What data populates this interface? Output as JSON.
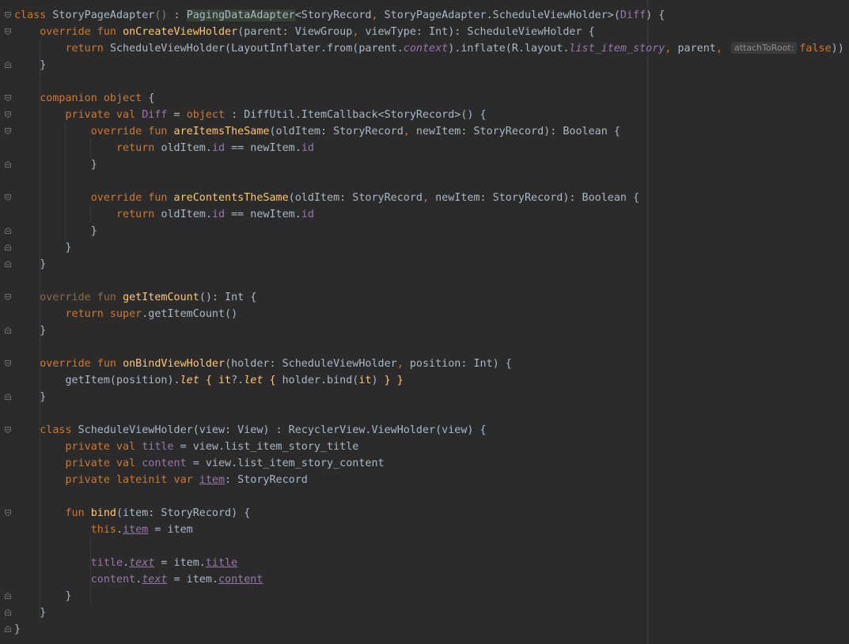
{
  "editor": {
    "right_margin_guide": true,
    "colors": {
      "background": "#2b2b2b",
      "default": "#a9b7c6",
      "keyword": "#cc7832",
      "function": "#ffc66d",
      "property": "#9876aa",
      "comment_like": "#808080"
    },
    "lines": [
      {
        "fold": "open",
        "tokens": [
          {
            "t": "class",
            "c": "kw"
          },
          {
            "t": " StoryPageAdapter",
            "c": ""
          },
          {
            "t": "()",
            "c": "dim"
          },
          {
            "t": " : ",
            "c": ""
          },
          {
            "t": "PagingDataAdapter",
            "c": "hl"
          },
          {
            "t": "<StoryRecord",
            "c": ""
          },
          {
            "t": ", ",
            "c": "kw"
          },
          {
            "t": "StoryPageAdapter.ScheduleViewHolder>(",
            "c": ""
          },
          {
            "t": "Diff",
            "c": "prop"
          },
          {
            "t": ") {",
            "c": ""
          }
        ]
      },
      {
        "fold": "open",
        "tokens": [
          {
            "t": "    override fun ",
            "c": "kw"
          },
          {
            "t": "onCreateViewHolder",
            "c": "fn"
          },
          {
            "t": "(parent: ViewGroup",
            "c": ""
          },
          {
            "t": ", ",
            "c": "kw"
          },
          {
            "t": "viewType: Int): ScheduleViewHolder {",
            "c": ""
          }
        ]
      },
      {
        "fold": "",
        "tokens": [
          {
            "t": "        return ",
            "c": "kw"
          },
          {
            "t": "ScheduleViewHolder(LayoutInflater.from(parent.",
            "c": ""
          },
          {
            "t": "context",
            "c": "prop ital"
          },
          {
            "t": ").inflate(R.layout.",
            "c": ""
          },
          {
            "t": "list_item_story",
            "c": "prop ital"
          },
          {
            "t": ", ",
            "c": "kw"
          },
          {
            "t": "parent",
            "c": ""
          },
          {
            "t": ", ",
            "c": "kw"
          },
          {
            "t": "attachToRoot:",
            "c": "hint"
          },
          {
            "t": "false",
            "c": "kw"
          },
          {
            "t": "))",
            "c": ""
          }
        ]
      },
      {
        "fold": "close",
        "tokens": [
          {
            "t": "    }",
            "c": ""
          }
        ]
      },
      {
        "fold": "",
        "tokens": []
      },
      {
        "fold": "open",
        "tokens": [
          {
            "t": "    companion object ",
            "c": "kw"
          },
          {
            "t": "{",
            "c": ""
          }
        ]
      },
      {
        "fold": "open",
        "tokens": [
          {
            "t": "        private val ",
            "c": "kw"
          },
          {
            "t": "Diff",
            "c": "prop"
          },
          {
            "t": " = ",
            "c": ""
          },
          {
            "t": "object",
            "c": "kw"
          },
          {
            "t": " : DiffUtil.ItemCallback<StoryRecord>() {",
            "c": ""
          }
        ]
      },
      {
        "fold": "open",
        "tokens": [
          {
            "t": "            override fun ",
            "c": "kw"
          },
          {
            "t": "areItemsTheSame",
            "c": "fn"
          },
          {
            "t": "(oldItem: StoryRecord",
            "c": ""
          },
          {
            "t": ", ",
            "c": "kw"
          },
          {
            "t": "newItem: StoryRecord): Boolean {",
            "c": ""
          }
        ]
      },
      {
        "fold": "",
        "tokens": [
          {
            "t": "                return ",
            "c": "kw"
          },
          {
            "t": "oldItem.",
            "c": ""
          },
          {
            "t": "id",
            "c": "prop"
          },
          {
            "t": " == newItem.",
            "c": ""
          },
          {
            "t": "id",
            "c": "prop"
          }
        ]
      },
      {
        "fold": "close",
        "tokens": [
          {
            "t": "            }",
            "c": ""
          }
        ]
      },
      {
        "fold": "",
        "tokens": []
      },
      {
        "fold": "open",
        "tokens": [
          {
            "t": "            override fun ",
            "c": "kw"
          },
          {
            "t": "areContentsTheSame",
            "c": "fn"
          },
          {
            "t": "(oldItem: StoryRecord",
            "c": ""
          },
          {
            "t": ", ",
            "c": "kw"
          },
          {
            "t": "newItem: StoryRecord): Boolean {",
            "c": ""
          }
        ]
      },
      {
        "fold": "",
        "tokens": [
          {
            "t": "                return ",
            "c": "kw"
          },
          {
            "t": "oldItem.",
            "c": ""
          },
          {
            "t": "id",
            "c": "prop"
          },
          {
            "t": " == newItem.",
            "c": ""
          },
          {
            "t": "id",
            "c": "prop"
          }
        ]
      },
      {
        "fold": "close",
        "tokens": [
          {
            "t": "            }",
            "c": ""
          }
        ]
      },
      {
        "fold": "close",
        "tokens": [
          {
            "t": "        }",
            "c": ""
          }
        ]
      },
      {
        "fold": "close",
        "tokens": [
          {
            "t": "    }",
            "c": ""
          }
        ]
      },
      {
        "fold": "",
        "tokens": []
      },
      {
        "fold": "open",
        "tokens": [
          {
            "t": "    override fun ",
            "c": "dimkw"
          },
          {
            "t": "getItemCount",
            "c": "fn"
          },
          {
            "t": "(): Int {",
            "c": ""
          }
        ]
      },
      {
        "fold": "",
        "tokens": [
          {
            "t": "        return super",
            "c": "kw"
          },
          {
            "t": ".getItemCount()",
            "c": ""
          }
        ]
      },
      {
        "fold": "close",
        "tokens": [
          {
            "t": "    }",
            "c": ""
          }
        ]
      },
      {
        "fold": "",
        "tokens": []
      },
      {
        "fold": "open",
        "tokens": [
          {
            "t": "    override fun ",
            "c": "kw"
          },
          {
            "t": "onBindViewHolder",
            "c": "fn"
          },
          {
            "t": "(holder: ScheduleViewHolder",
            "c": ""
          },
          {
            "t": ", ",
            "c": "kw"
          },
          {
            "t": "position: Int) {",
            "c": ""
          }
        ]
      },
      {
        "fold": "",
        "tokens": [
          {
            "t": "        getItem(position).",
            "c": ""
          },
          {
            "t": "let",
            "c": "fn ital"
          },
          {
            "t": " { ",
            "c": "fn"
          },
          {
            "t": "it",
            "c": "fn"
          },
          {
            "t": "?.",
            "c": ""
          },
          {
            "t": "let",
            "c": "fn ital"
          },
          {
            "t": " { ",
            "c": "fn"
          },
          {
            "t": "holder.bind(",
            "c": ""
          },
          {
            "t": "it",
            "c": "fn"
          },
          {
            "t": ") ",
            "c": ""
          },
          {
            "t": "} }",
            "c": "fn"
          }
        ]
      },
      {
        "fold": "close",
        "tokens": [
          {
            "t": "    }",
            "c": ""
          }
        ]
      },
      {
        "fold": "",
        "tokens": []
      },
      {
        "fold": "open",
        "tokens": [
          {
            "t": "    class ",
            "c": "kw"
          },
          {
            "t": "ScheduleViewHolder(view: View) : RecyclerView.ViewHolder(view) {",
            "c": ""
          }
        ]
      },
      {
        "fold": "",
        "tokens": [
          {
            "t": "        private val ",
            "c": "kw"
          },
          {
            "t": "title",
            "c": "prop"
          },
          {
            "t": " = view.list_item_story_title",
            "c": ""
          }
        ]
      },
      {
        "fold": "",
        "tokens": [
          {
            "t": "        private val ",
            "c": "kw"
          },
          {
            "t": "content",
            "c": "prop"
          },
          {
            "t": " = view.list_item_story_content",
            "c": ""
          }
        ]
      },
      {
        "fold": "",
        "tokens": [
          {
            "t": "        private lateinit var ",
            "c": "kw"
          },
          {
            "t": "item",
            "c": "prop ul"
          },
          {
            "t": ": StoryRecord",
            "c": ""
          }
        ]
      },
      {
        "fold": "",
        "tokens": []
      },
      {
        "fold": "open",
        "tokens": [
          {
            "t": "        fun ",
            "c": "kw"
          },
          {
            "t": "bind",
            "c": "fn"
          },
          {
            "t": "(item: StoryRecord) {",
            "c": ""
          }
        ]
      },
      {
        "fold": "",
        "tokens": [
          {
            "t": "            this",
            "c": "kw"
          },
          {
            "t": ".",
            "c": ""
          },
          {
            "t": "item",
            "c": "prop ul"
          },
          {
            "t": " = item",
            "c": ""
          }
        ]
      },
      {
        "fold": "",
        "tokens": []
      },
      {
        "fold": "",
        "tokens": [
          {
            "t": "            title",
            "c": "prop"
          },
          {
            "t": ".",
            "c": ""
          },
          {
            "t": "text",
            "c": "prop ital ul"
          },
          {
            "t": " = item.",
            "c": ""
          },
          {
            "t": "title",
            "c": "prop ul"
          }
        ]
      },
      {
        "fold": "",
        "tokens": [
          {
            "t": "            content",
            "c": "prop"
          },
          {
            "t": ".",
            "c": ""
          },
          {
            "t": "text",
            "c": "prop ital ul"
          },
          {
            "t": " = item.",
            "c": ""
          },
          {
            "t": "content",
            "c": "prop ul"
          }
        ]
      },
      {
        "fold": "close",
        "tokens": [
          {
            "t": "        }",
            "c": ""
          }
        ]
      },
      {
        "fold": "close",
        "tokens": [
          {
            "t": "    }",
            "c": ""
          }
        ]
      },
      {
        "fold": "close",
        "tokens": [
          {
            "t": "}",
            "c": ""
          }
        ]
      }
    ]
  }
}
